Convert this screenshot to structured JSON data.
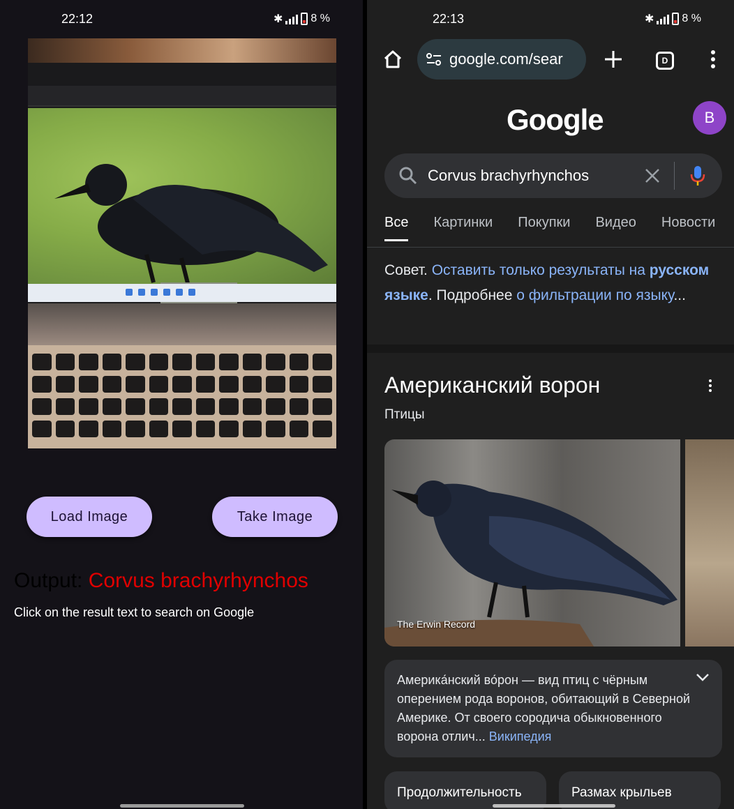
{
  "left_app": {
    "status": {
      "time": "22:12",
      "battery": "8 %"
    },
    "buttons": {
      "load": "Load Image",
      "take": "Take Image"
    },
    "output": {
      "label": "Output:",
      "result": "Corvus brachyrhynchos"
    },
    "hint": "Click on the result text to search on Google"
  },
  "browser": {
    "status": {
      "time": "22:13",
      "battery": "8 %"
    },
    "url": "google.com/sear",
    "tabs_count": "D",
    "logo": "Google",
    "avatar_letter": "B",
    "search_query": "Corvus brachyrhynchos",
    "tabs": [
      "Все",
      "Картинки",
      "Покупки",
      "Видео",
      "Новости"
    ],
    "advice": {
      "prefix": "Совет.",
      "link1": "Оставить только результаты на",
      "link1_bold": "русском языке",
      "middle": ". Подробнее",
      "link2": "о фильтрации по языку",
      "suffix": "..."
    },
    "knowledge": {
      "title": "Американский ворон",
      "subtitle": "Птицы",
      "image_caption": "The Erwin Record",
      "description": "Америка́нский во́рон — вид птиц с чёрным оперением рода воронов, обитающий в Северной Америке. От своего сородича обыкновенного ворона отлич...",
      "source": "Википедия",
      "chips": [
        "Продолжительность",
        "Размах крыльев"
      ]
    }
  },
  "colors": {
    "accent_button": "#cfbcff",
    "result_red": "#e00000",
    "link_blue": "#8ab4f8",
    "avatar": "#8e44c8"
  }
}
